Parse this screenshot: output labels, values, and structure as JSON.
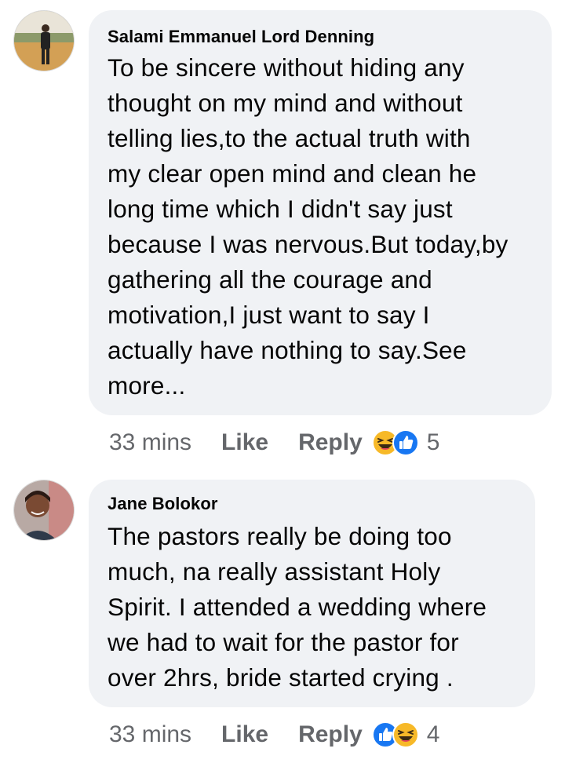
{
  "comments": [
    {
      "author": "Salami Emmanuel Lord Denning",
      "text": "To be sincere without hiding any\nthought on my mind and without\ntelling lies,to the actual truth with\nmy clear open mind and clean he\nlong time which I didn't say just\nbecause I was nervous.But today,by\ngathering all the courage and\nmotivation,I just want to say I\nactually have nothing to say.See\nmore...",
      "time": "33 mins",
      "like_label": "Like",
      "reply_label": "Reply",
      "reactions": [
        "haha-icon",
        "like-icon"
      ],
      "reaction_count": "5"
    },
    {
      "author": "Jane Bolokor",
      "text": "The pastors really be doing too\nmuch, na really assistant Holy\nSpirit.  I attended a wedding where\nwe had to wait for the pastor for\nover 2hrs, bride started crying .",
      "time": "33 mins",
      "like_label": "Like",
      "reply_label": "Reply",
      "reactions": [
        "like-icon",
        "haha-icon"
      ],
      "reaction_count": "4"
    }
  ],
  "colors": {
    "bubble": "#f0f2f5",
    "text": "#050505",
    "secondary": "#65676b",
    "like_blue": "#1877f2",
    "haha_yellow": "#f7b928"
  }
}
